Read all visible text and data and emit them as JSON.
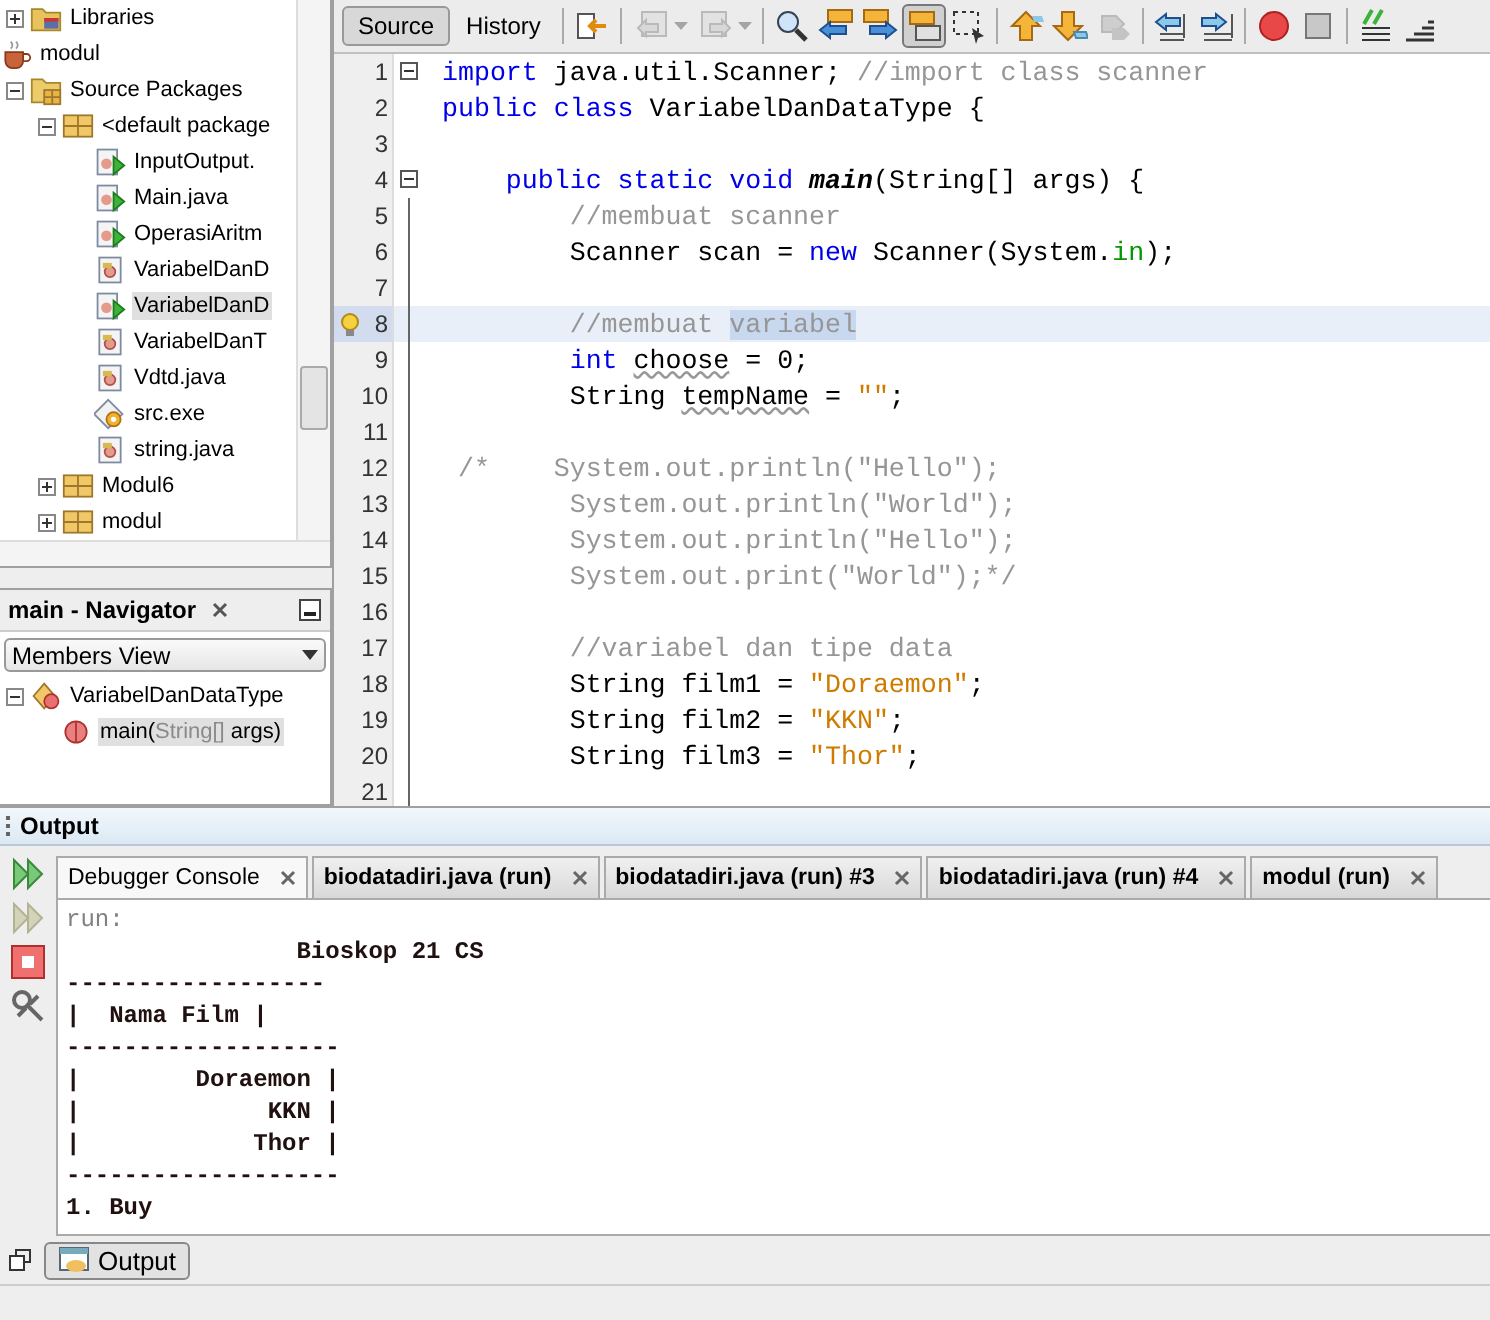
{
  "project_tree": [
    {
      "label": "Libraries",
      "kind": "library",
      "expanded": false,
      "selected": false
    },
    {
      "label": "modul",
      "kind": "project",
      "selected": false,
      "children": [
        {
          "label": "Source Packages",
          "kind": "sources",
          "expanded": true,
          "selected": false,
          "children": [
            {
              "label": "<default package",
              "kind": "package",
              "expanded": true,
              "selected": false,
              "children": [
                {
                  "label": "InputOutput.",
                  "kind": "main-class",
                  "selected": false
                },
                {
                  "label": "Main.java",
                  "kind": "main-class",
                  "selected": false
                },
                {
                  "label": "OperasiAritm",
                  "kind": "main-class",
                  "selected": false
                },
                {
                  "label": "VariabelDanD",
                  "kind": "class",
                  "selected": false
                },
                {
                  "label": "VariabelDanD",
                  "kind": "main-class",
                  "selected": true
                },
                {
                  "label": "VariabelDanT",
                  "kind": "class",
                  "selected": false
                },
                {
                  "label": "Vdtd.java",
                  "kind": "class",
                  "selected": false
                },
                {
                  "label": "src.exe",
                  "kind": "exe",
                  "selected": false
                },
                {
                  "label": "string.java",
                  "kind": "class",
                  "selected": false
                }
              ]
            },
            {
              "label": "Modul6",
              "kind": "package",
              "expanded": false,
              "selected": false
            },
            {
              "label": "modul",
              "kind": "package",
              "expanded": false,
              "selected": false
            }
          ]
        }
      ]
    }
  ],
  "navigator": {
    "title": "main - Navigator",
    "view": "Members View",
    "class_name": "VariabelDanDataType",
    "expanded": true,
    "members": [
      {
        "parts": [
          {
            "text": "main(",
            "kind": "name"
          },
          {
            "text": "String[]",
            "kind": "type"
          },
          {
            "text": " args)",
            "kind": "name"
          }
        ],
        "selected": true
      }
    ]
  },
  "editor": {
    "tabs": [
      {
        "label": "Source",
        "selected": true
      },
      {
        "label": "History",
        "selected": false
      }
    ],
    "toolbar": [
      [
        {
          "kind": "last-edit",
          "disabled": false,
          "pressed": false,
          "dropdown": false
        }
      ],
      [
        {
          "kind": "back",
          "disabled": true,
          "pressed": false,
          "dropdown": true
        },
        {
          "kind": "forward",
          "disabled": true,
          "pressed": false,
          "dropdown": true
        }
      ],
      [
        {
          "kind": "find",
          "disabled": false,
          "pressed": false,
          "dropdown": false
        },
        {
          "kind": "find-previous",
          "disabled": false,
          "pressed": false,
          "dropdown": false
        },
        {
          "kind": "find-next",
          "disabled": false,
          "pressed": false,
          "dropdown": false
        },
        {
          "kind": "highlight",
          "disabled": false,
          "pressed": true,
          "dropdown": false
        },
        {
          "kind": "select-rect",
          "disabled": false,
          "pressed": false,
          "dropdown": false
        }
      ],
      [
        {
          "kind": "bookmark-up",
          "disabled": false,
          "pressed": false,
          "dropdown": false
        },
        {
          "kind": "bookmark-down",
          "disabled": false,
          "pressed": false,
          "dropdown": false
        },
        {
          "kind": "bookmark-toggle",
          "disabled": true,
          "pressed": false,
          "dropdown": false
        }
      ],
      [
        {
          "kind": "shift-left",
          "disabled": false,
          "pressed": false,
          "dropdown": false
        },
        {
          "kind": "shift-right",
          "disabled": false,
          "pressed": false,
          "dropdown": false
        }
      ],
      [
        {
          "kind": "record",
          "disabled": false,
          "pressed": false,
          "dropdown": false
        },
        {
          "kind": "stop",
          "disabled": false,
          "pressed": false,
          "dropdown": false
        }
      ],
      [
        {
          "kind": "comment",
          "disabled": false,
          "pressed": false,
          "dropdown": false
        },
        {
          "kind": "uncomment",
          "disabled": false,
          "pressed": false,
          "dropdown": false
        }
      ]
    ],
    "lines": [
      {
        "number": "1",
        "fold_marker": true,
        "in_fold": false,
        "current": false,
        "hint": false,
        "tokens": [
          {
            "kind": "kw",
            "text": "import"
          },
          {
            "kind": "text",
            "text": " java.util.Scanner; "
          },
          {
            "kind": "comment",
            "text": "//import class scanner"
          }
        ]
      },
      {
        "number": "2",
        "fold_marker": false,
        "in_fold": false,
        "current": false,
        "hint": false,
        "tokens": [
          {
            "kind": "kw",
            "text": "public class"
          },
          {
            "kind": "text",
            "text": " VariabelDanDataType {"
          }
        ]
      },
      {
        "number": "3",
        "fold_marker": false,
        "in_fold": false,
        "current": false,
        "hint": false
      },
      {
        "number": "4",
        "fold_marker": true,
        "in_fold": false,
        "current": false,
        "hint": false,
        "tokens": [
          {
            "kind": "kw",
            "text": "    public static void"
          },
          {
            "kind": "method",
            "text": " main"
          },
          {
            "kind": "text",
            "text": "(String[] args) {"
          }
        ]
      },
      {
        "number": "5",
        "fold_marker": false,
        "in_fold": true,
        "current": false,
        "hint": false,
        "tokens": [
          {
            "kind": "comment",
            "text": "        //membuat scanner"
          }
        ]
      },
      {
        "number": "6",
        "fold_marker": false,
        "in_fold": true,
        "current": false,
        "hint": false,
        "tokens": [
          {
            "kind": "text",
            "text": "        Scanner scan = "
          },
          {
            "kind": "kw",
            "text": "new"
          },
          {
            "kind": "text",
            "text": " Scanner(System."
          },
          {
            "kind": "field",
            "text": "in"
          },
          {
            "kind": "text",
            "text": ");"
          }
        ]
      },
      {
        "number": "7",
        "fold_marker": false,
        "in_fold": true,
        "current": false,
        "hint": false
      },
      {
        "number": "8",
        "fold_marker": false,
        "in_fold": true,
        "current": true,
        "hint": true,
        "tokens": [
          {
            "kind": "comment",
            "text": "        //membuat "
          },
          {
            "kind": "selection",
            "text": "variabel"
          }
        ]
      },
      {
        "number": "9",
        "fold_marker": false,
        "in_fold": true,
        "current": false,
        "hint": false,
        "tokens": [
          {
            "kind": "kw",
            "text": "        int "
          },
          {
            "kind": "warning",
            "text": "choose"
          },
          {
            "kind": "text",
            "text": " = 0;"
          }
        ]
      },
      {
        "number": "10",
        "fold_marker": false,
        "in_fold": true,
        "current": false,
        "hint": false,
        "tokens": [
          {
            "kind": "text",
            "text": "        String "
          },
          {
            "kind": "warning",
            "text": "tempName"
          },
          {
            "kind": "text",
            "text": " = "
          },
          {
            "kind": "string",
            "text": "\"\""
          },
          {
            "kind": "text",
            "text": ";"
          }
        ]
      },
      {
        "number": "11",
        "fold_marker": false,
        "in_fold": true,
        "current": false,
        "hint": false
      },
      {
        "number": "12",
        "fold_marker": false,
        "in_fold": true,
        "current": false,
        "hint": false,
        "tokens": [
          {
            "kind": "comment",
            "text": " /*    System.out.println(\"Hello\");"
          }
        ]
      },
      {
        "number": "13",
        "fold_marker": false,
        "in_fold": true,
        "current": false,
        "hint": false,
        "tokens": [
          {
            "kind": "comment",
            "text": "        System.out.println(\"World\");"
          }
        ]
      },
      {
        "number": "14",
        "fold_marker": false,
        "in_fold": true,
        "current": false,
        "hint": false,
        "tokens": [
          {
            "kind": "comment",
            "text": "        System.out.println(\"Hello\");"
          }
        ]
      },
      {
        "number": "15",
        "fold_marker": false,
        "in_fold": true,
        "current": false,
        "hint": false,
        "tokens": [
          {
            "kind": "comment",
            "text": "        System.out.print(\"World\");*/"
          }
        ]
      },
      {
        "number": "16",
        "fold_marker": false,
        "in_fold": true,
        "current": false,
        "hint": false
      },
      {
        "number": "17",
        "fold_marker": false,
        "in_fold": true,
        "current": false,
        "hint": false,
        "tokens": [
          {
            "kind": "comment",
            "text": "        //variabel dan tipe data"
          }
        ]
      },
      {
        "number": "18",
        "fold_marker": false,
        "in_fold": true,
        "current": false,
        "hint": false,
        "tokens": [
          {
            "kind": "text",
            "text": "        String film1 = "
          },
          {
            "kind": "string",
            "text": "\"Doraemon\""
          },
          {
            "kind": "text",
            "text": ";"
          }
        ]
      },
      {
        "number": "19",
        "fold_marker": false,
        "in_fold": true,
        "current": false,
        "hint": false,
        "tokens": [
          {
            "kind": "text",
            "text": "        String film2 = "
          },
          {
            "kind": "string",
            "text": "\"KKN\""
          },
          {
            "kind": "text",
            "text": ";"
          }
        ]
      },
      {
        "number": "20",
        "fold_marker": false,
        "in_fold": true,
        "current": false,
        "hint": false,
        "tokens": [
          {
            "kind": "text",
            "text": "        String film3 = "
          },
          {
            "kind": "string",
            "text": "\"Thor\""
          },
          {
            "kind": "text",
            "text": ";"
          }
        ]
      },
      {
        "number": "21",
        "fold_marker": false,
        "in_fold": true,
        "current": false,
        "hint": false
      }
    ]
  },
  "output": {
    "title": "Output",
    "actions": [
      {
        "kind": "rerun",
        "disabled": false
      },
      {
        "kind": "rerun-options",
        "disabled": true
      },
      {
        "kind": "stop",
        "disabled": false
      },
      {
        "kind": "settings",
        "disabled": false
      }
    ],
    "tabs": [
      {
        "label": "Debugger Console",
        "selected": true,
        "running": false
      },
      {
        "label": "biodatadiri.java (run)",
        "selected": false,
        "running": true
      },
      {
        "label": "biodatadiri.java (run) #3",
        "selected": false,
        "running": true
      },
      {
        "label": "biodatadiri.java (run) #4",
        "selected": false,
        "running": true
      },
      {
        "label": "modul (run)",
        "selected": false,
        "running": true
      }
    ],
    "console": [
      {
        "kind": "system",
        "text": "run:"
      },
      {
        "kind": "out",
        "text": "                Bioskop 21 CS"
      },
      {
        "kind": "out",
        "text": "------------------"
      },
      {
        "kind": "out",
        "text": "|  Nama Film |"
      },
      {
        "kind": "out",
        "text": "-------------------"
      },
      {
        "kind": "out",
        "text": "|        Doraemon |"
      },
      {
        "kind": "out",
        "text": "|             KKN |"
      },
      {
        "kind": "out",
        "text": "|            Thor |"
      },
      {
        "kind": "out",
        "text": "-------------------"
      },
      {
        "kind": "out",
        "text": "1. Buy"
      }
    ]
  },
  "bottom_bar": {
    "buttons": [
      {
        "label": "Output",
        "selected": true
      }
    ]
  }
}
